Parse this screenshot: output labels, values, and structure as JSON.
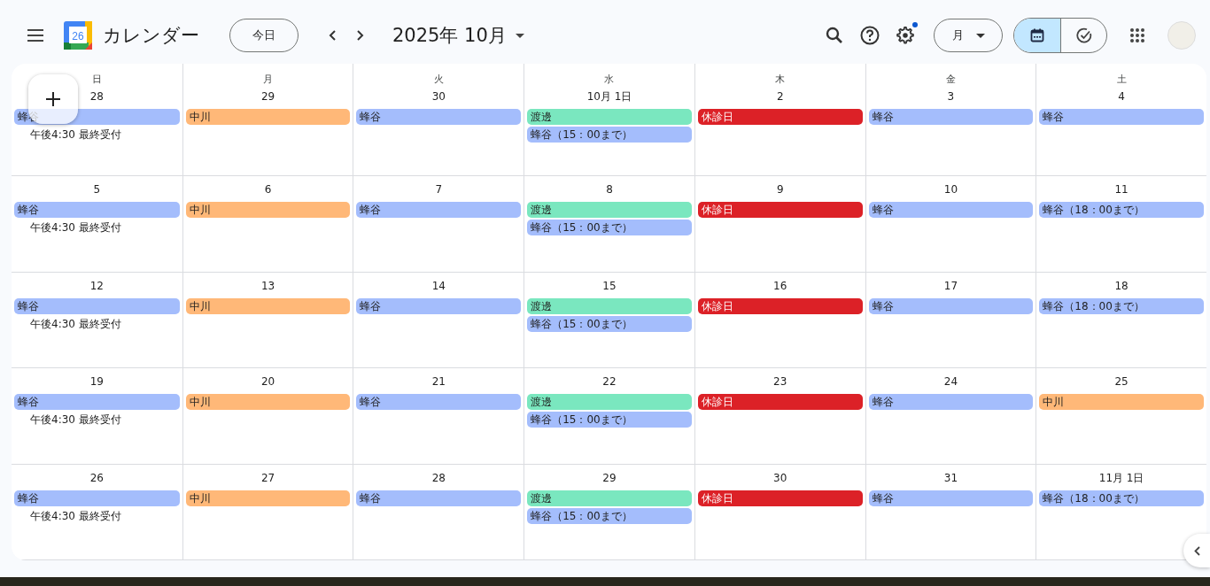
{
  "header": {
    "logo_number": "26",
    "app_title": "カレンダー",
    "today_button": "今日",
    "period_title": "2025年 10月",
    "settings_badge": true,
    "view_button": "月",
    "view_toggle": [
      {
        "kind": "calendar",
        "selected": true
      },
      {
        "kind": "tasks",
        "selected": false
      }
    ]
  },
  "weekdays": [
    "日",
    "月",
    "火",
    "水",
    "木",
    "金",
    "土"
  ],
  "weeks": [
    [
      {
        "date": "28",
        "events": [
          {
            "kind": "chip",
            "title": "蜂谷",
            "color": "#a4bdfc"
          },
          {
            "kind": "timed",
            "title": "午後4:30 最終受付"
          }
        ]
      },
      {
        "date": "29",
        "events": [
          {
            "kind": "chip",
            "title": "中川",
            "color": "#ffb878"
          }
        ]
      },
      {
        "date": "30",
        "events": [
          {
            "kind": "chip",
            "title": "蜂谷",
            "color": "#a4bdfc"
          }
        ]
      },
      {
        "date": "10月 1日",
        "events": [
          {
            "kind": "chip",
            "title": "渡邊",
            "color": "#7ae7bf"
          },
          {
            "kind": "chip",
            "title": "蜂谷（15：00まで）",
            "color": "#a4bdfc"
          }
        ]
      },
      {
        "date": "2",
        "events": [
          {
            "kind": "chip",
            "title": "休診日",
            "color": "#dc2127"
          }
        ]
      },
      {
        "date": "3",
        "events": [
          {
            "kind": "chip",
            "title": "蜂谷",
            "color": "#a4bdfc"
          }
        ]
      },
      {
        "date": "4",
        "events": [
          {
            "kind": "chip",
            "title": "蜂谷",
            "color": "#a4bdfc"
          }
        ]
      }
    ],
    [
      {
        "date": "5",
        "events": [
          {
            "kind": "chip",
            "title": "蜂谷",
            "color": "#a4bdfc"
          },
          {
            "kind": "timed",
            "title": "午後4:30 最終受付"
          }
        ]
      },
      {
        "date": "6",
        "events": [
          {
            "kind": "chip",
            "title": "中川",
            "color": "#ffb878"
          }
        ]
      },
      {
        "date": "7",
        "events": [
          {
            "kind": "chip",
            "title": "蜂谷",
            "color": "#a4bdfc"
          }
        ]
      },
      {
        "date": "8",
        "events": [
          {
            "kind": "chip",
            "title": "渡邊",
            "color": "#7ae7bf"
          },
          {
            "kind": "chip",
            "title": "蜂谷（15：00まで）",
            "color": "#a4bdfc"
          }
        ]
      },
      {
        "date": "9",
        "events": [
          {
            "kind": "chip",
            "title": "休診日",
            "color": "#dc2127"
          }
        ]
      },
      {
        "date": "10",
        "events": [
          {
            "kind": "chip",
            "title": "蜂谷",
            "color": "#a4bdfc"
          }
        ]
      },
      {
        "date": "11",
        "events": [
          {
            "kind": "chip",
            "title": "蜂谷（18：00まで）",
            "color": "#a4bdfc"
          }
        ]
      }
    ],
    [
      {
        "date": "12",
        "events": [
          {
            "kind": "chip",
            "title": "蜂谷",
            "color": "#a4bdfc"
          },
          {
            "kind": "timed",
            "title": "午後4:30 最終受付"
          }
        ]
      },
      {
        "date": "13",
        "events": [
          {
            "kind": "chip",
            "title": "中川",
            "color": "#ffb878"
          }
        ]
      },
      {
        "date": "14",
        "events": [
          {
            "kind": "chip",
            "title": "蜂谷",
            "color": "#a4bdfc"
          }
        ]
      },
      {
        "date": "15",
        "events": [
          {
            "kind": "chip",
            "title": "渡邊",
            "color": "#7ae7bf"
          },
          {
            "kind": "chip",
            "title": "蜂谷（15：00まで）",
            "color": "#a4bdfc"
          }
        ]
      },
      {
        "date": "16",
        "events": [
          {
            "kind": "chip",
            "title": "休診日",
            "color": "#dc2127"
          }
        ]
      },
      {
        "date": "17",
        "events": [
          {
            "kind": "chip",
            "title": "蜂谷",
            "color": "#a4bdfc"
          }
        ]
      },
      {
        "date": "18",
        "events": [
          {
            "kind": "chip",
            "title": "蜂谷（18：00まで）",
            "color": "#a4bdfc"
          }
        ]
      }
    ],
    [
      {
        "date": "19",
        "events": [
          {
            "kind": "chip",
            "title": "蜂谷",
            "color": "#a4bdfc"
          },
          {
            "kind": "timed",
            "title": "午後4:30 最終受付"
          }
        ]
      },
      {
        "date": "20",
        "events": [
          {
            "kind": "chip",
            "title": "中川",
            "color": "#ffb878"
          }
        ]
      },
      {
        "date": "21",
        "events": [
          {
            "kind": "chip",
            "title": "蜂谷",
            "color": "#a4bdfc"
          }
        ]
      },
      {
        "date": "22",
        "events": [
          {
            "kind": "chip",
            "title": "渡邊",
            "color": "#7ae7bf"
          },
          {
            "kind": "chip",
            "title": "蜂谷（15：00まで）",
            "color": "#a4bdfc"
          }
        ]
      },
      {
        "date": "23",
        "events": [
          {
            "kind": "chip",
            "title": "休診日",
            "color": "#dc2127"
          }
        ]
      },
      {
        "date": "24",
        "events": [
          {
            "kind": "chip",
            "title": "蜂谷",
            "color": "#a4bdfc"
          }
        ]
      },
      {
        "date": "25",
        "events": [
          {
            "kind": "chip",
            "title": "中川",
            "color": "#ffb878"
          }
        ]
      }
    ],
    [
      {
        "date": "26",
        "events": [
          {
            "kind": "chip",
            "title": "蜂谷",
            "color": "#a4bdfc"
          },
          {
            "kind": "timed",
            "title": "午後4:30 最終受付"
          }
        ]
      },
      {
        "date": "27",
        "events": [
          {
            "kind": "chip",
            "title": "中川",
            "color": "#ffb878"
          }
        ]
      },
      {
        "date": "28",
        "events": [
          {
            "kind": "chip",
            "title": "蜂谷",
            "color": "#a4bdfc"
          }
        ]
      },
      {
        "date": "29",
        "events": [
          {
            "kind": "chip",
            "title": "渡邊",
            "color": "#7ae7bf"
          },
          {
            "kind": "chip",
            "title": "蜂谷（15：00まで）",
            "color": "#a4bdfc"
          }
        ]
      },
      {
        "date": "30",
        "events": [
          {
            "kind": "chip",
            "title": "休診日",
            "color": "#dc2127"
          }
        ]
      },
      {
        "date": "31",
        "events": [
          {
            "kind": "chip",
            "title": "蜂谷",
            "color": "#a4bdfc"
          }
        ]
      },
      {
        "date": "11月 1日",
        "events": [
          {
            "kind": "chip",
            "title": "蜂谷（18：00まで）",
            "color": "#a4bdfc"
          }
        ]
      }
    ]
  ]
}
